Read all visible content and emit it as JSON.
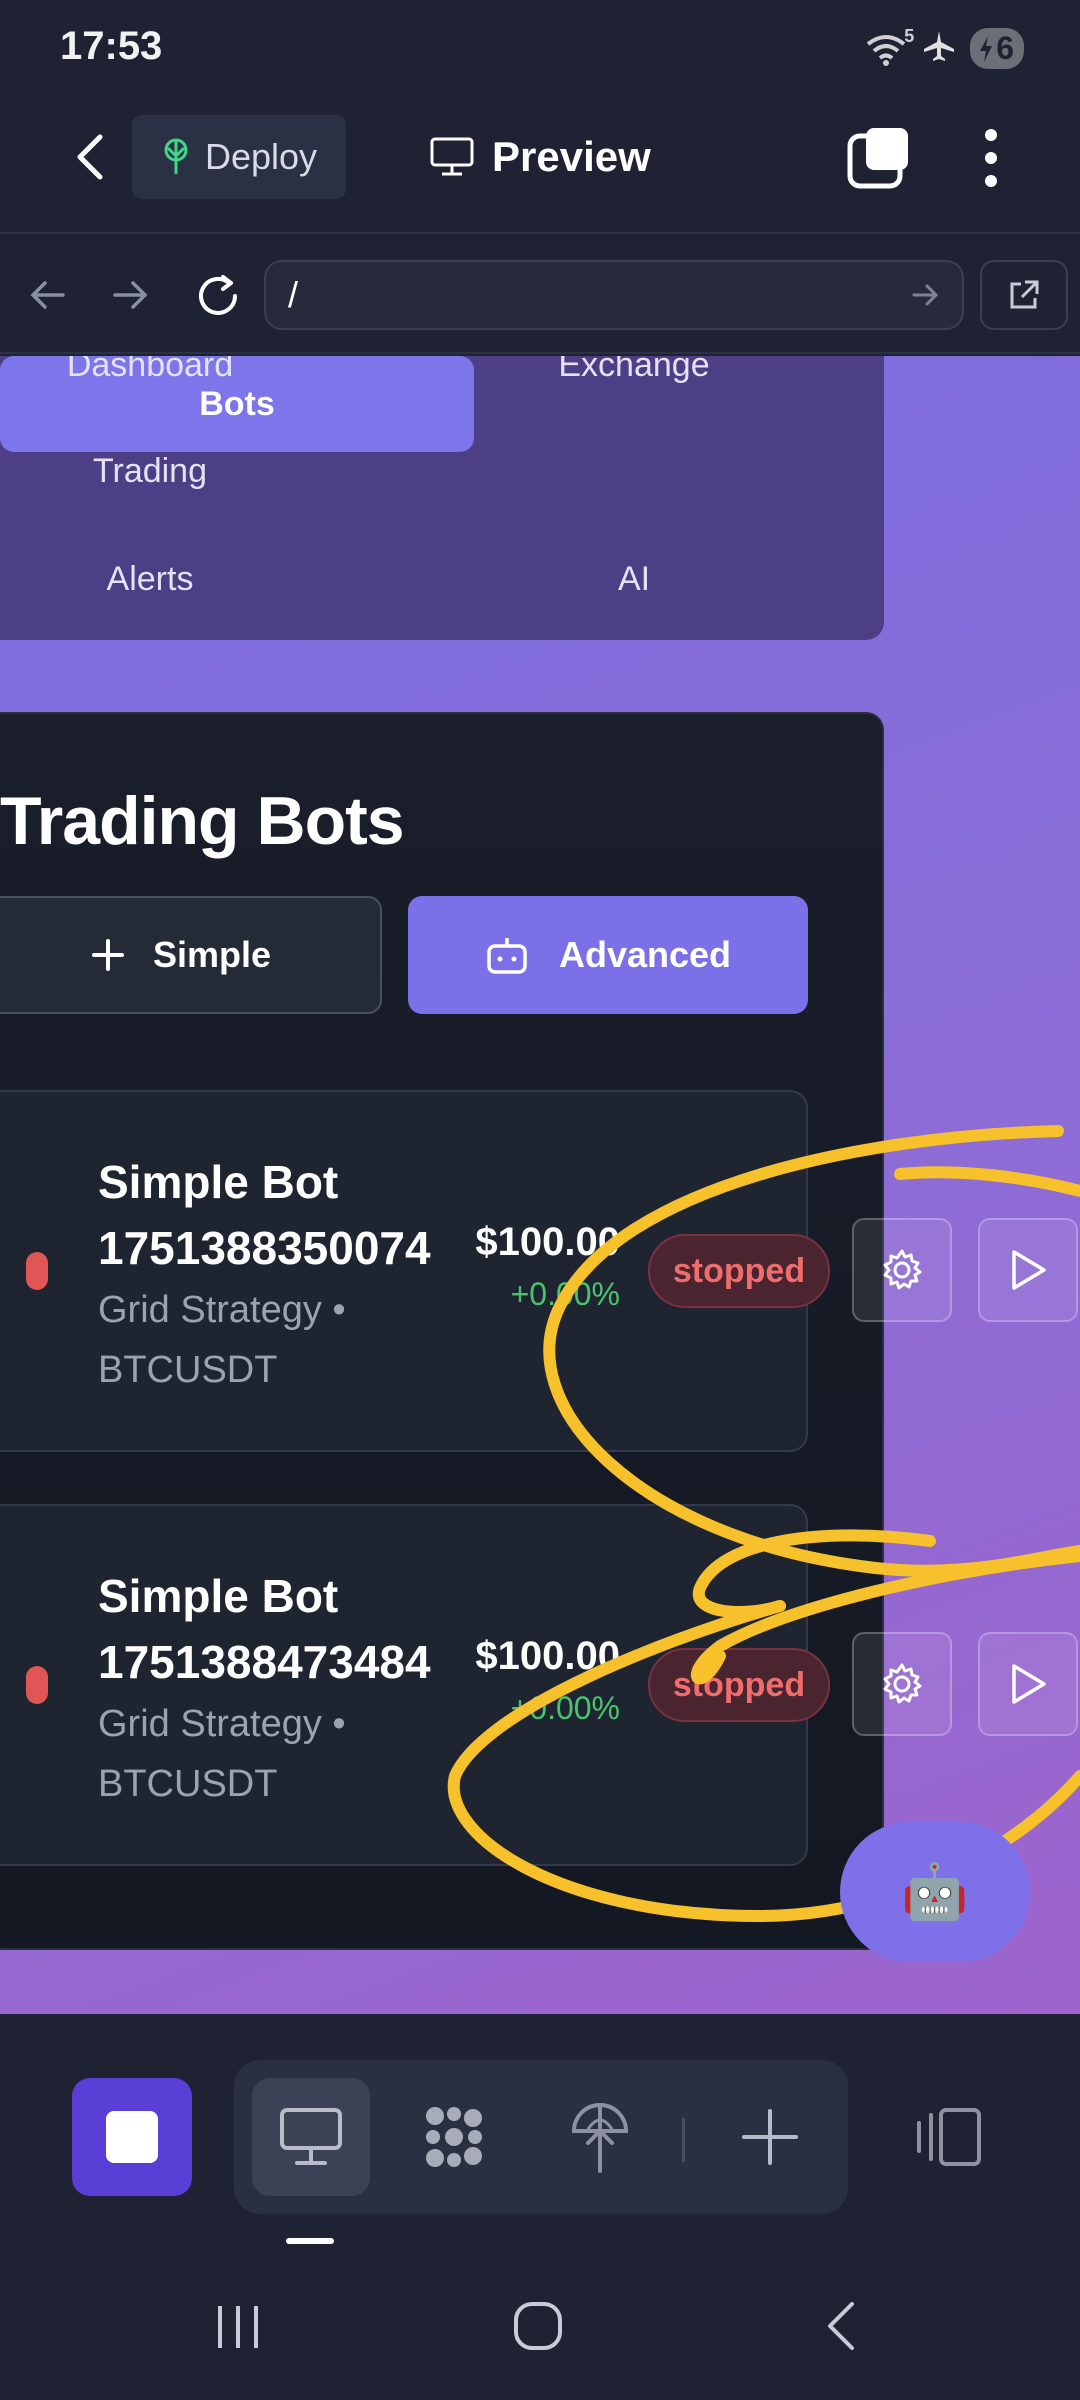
{
  "status_bar": {
    "time": "17:53",
    "wifi_badge": "5",
    "battery": "6"
  },
  "app_bar": {
    "deploy_label": "Deploy",
    "preview_label": "Preview"
  },
  "url_bar": {
    "url": "/"
  },
  "site_nav": {
    "items": [
      "Dashboard",
      "Exchange",
      "Trading",
      "Bots",
      "Alerts",
      "AI"
    ],
    "active": "Bots"
  },
  "bots_section": {
    "title": "Trading Bots",
    "simple_label": "Simple",
    "advanced_label": "Advanced",
    "bots": [
      {
        "name_line1": "Simple Bot",
        "name_line2": "1751388350074",
        "strategy_line1": "Grid Strategy •",
        "strategy_line2": "BTCUSDT",
        "price": "$100.00",
        "change": "+0.00%",
        "status": "stopped"
      },
      {
        "name_line1": "Simple Bot",
        "name_line2": "1751388473484",
        "strategy_line1": "Grid Strategy •",
        "strategy_line2": "BTCUSDT",
        "price": "$100.00",
        "change": "+0.00%",
        "status": "stopped"
      }
    ]
  },
  "fab": {
    "icon": "🤖"
  },
  "colors": {
    "accent": "#7b70e8",
    "status_stopped": "#ef6d6d",
    "gain": "#49c46c",
    "scribble": "#f6c12a"
  }
}
